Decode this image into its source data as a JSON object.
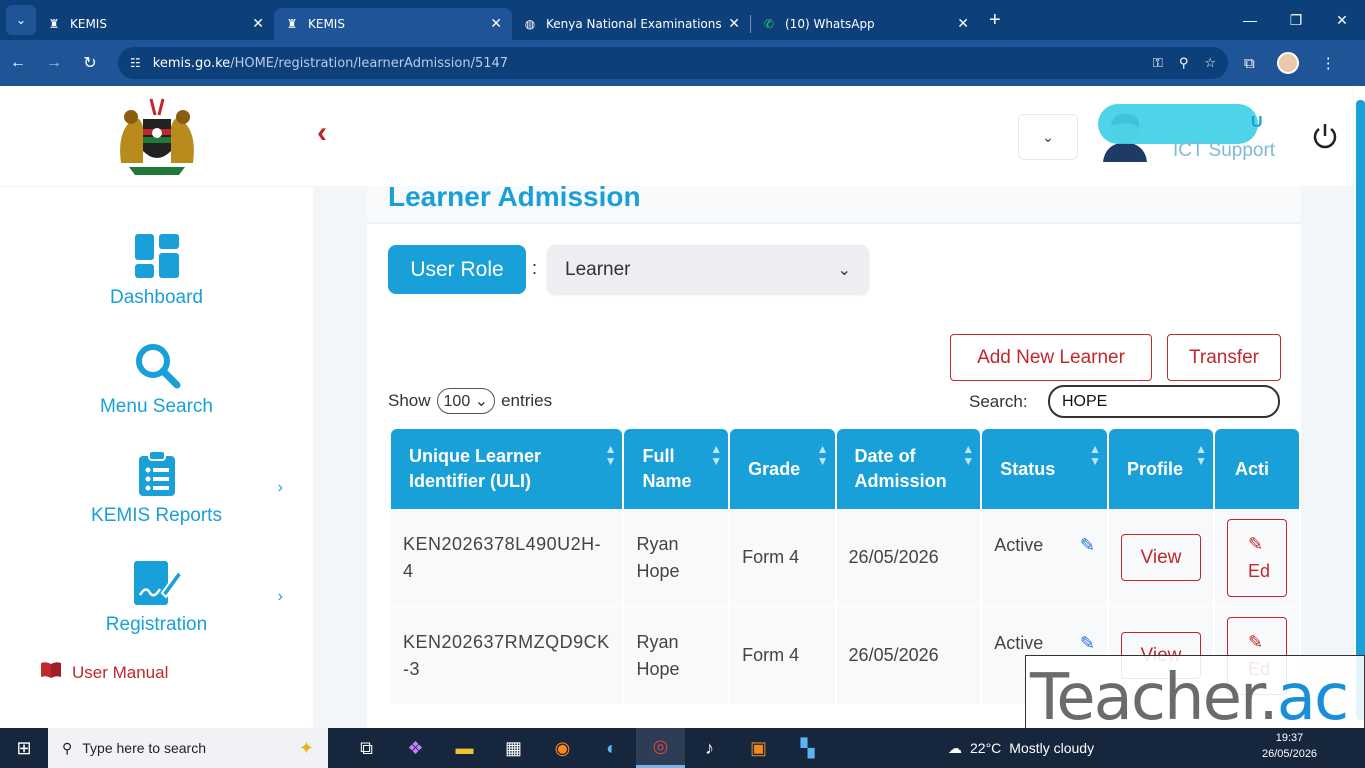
{
  "browser": {
    "tabs": [
      {
        "title": "KEMIS",
        "active": false
      },
      {
        "title": "KEMIS",
        "active": true
      },
      {
        "title": "Kenya National Examinations C",
        "active": false
      },
      {
        "title": "(10) WhatsApp",
        "active": false
      }
    ],
    "url_host": "kemis.go.ke",
    "url_path": "/HOME/registration/learnerAdmission/5147"
  },
  "sidebar": {
    "items": [
      {
        "label": "Dashboard",
        "icon": "dashboard-icon"
      },
      {
        "label": "Menu Search",
        "icon": "search-icon"
      },
      {
        "label": "KEMIS Reports",
        "icon": "clipboard-icon",
        "has_chevron": true
      },
      {
        "label": "Registration",
        "icon": "register-icon",
        "has_chevron": true
      }
    ],
    "manual_label": "User Manual"
  },
  "header": {
    "user_name_tail": "U",
    "user_role": "ICT Support"
  },
  "page": {
    "title": "Learner Admission",
    "role_label": "User Role",
    "role_value": "Learner",
    "add_button": "Add New Learner",
    "transfer_button": "Transfer",
    "show_label": "Show",
    "entries_value": "100",
    "entries_label": "entries",
    "search_label": "Search:",
    "search_value": "HOPE"
  },
  "table": {
    "columns": [
      "Unique Learner Identifier (ULI)",
      "Full Name",
      "Grade",
      "Date of Admission",
      "Status",
      "Profile",
      "Acti"
    ],
    "rows": [
      {
        "uli": "KEN2026378L490U2H-4",
        "name": "Ryan Hope",
        "grade": "Form 4",
        "date": "26/05/2026",
        "status": "Active",
        "profile": "View",
        "action": "Ed"
      },
      {
        "uli": "KEN202637RMZQD9CK-3",
        "name": "Ryan Hope",
        "grade": "Form 4",
        "date": "26/05/2026",
        "status": "Active",
        "profile": "View",
        "action": "Ed"
      }
    ]
  },
  "watermark": {
    "part1": "Teacher.",
    "part2": "ac"
  },
  "taskbar": {
    "search_placeholder": "Type here to search",
    "temperature": "22°C",
    "weather": "Mostly cloudy",
    "time": "19:37",
    "date": "26/05/2026"
  },
  "colors": {
    "accent": "#1aa0d8",
    "danger": "#c0282e",
    "chrome": "#0d3f7a"
  }
}
